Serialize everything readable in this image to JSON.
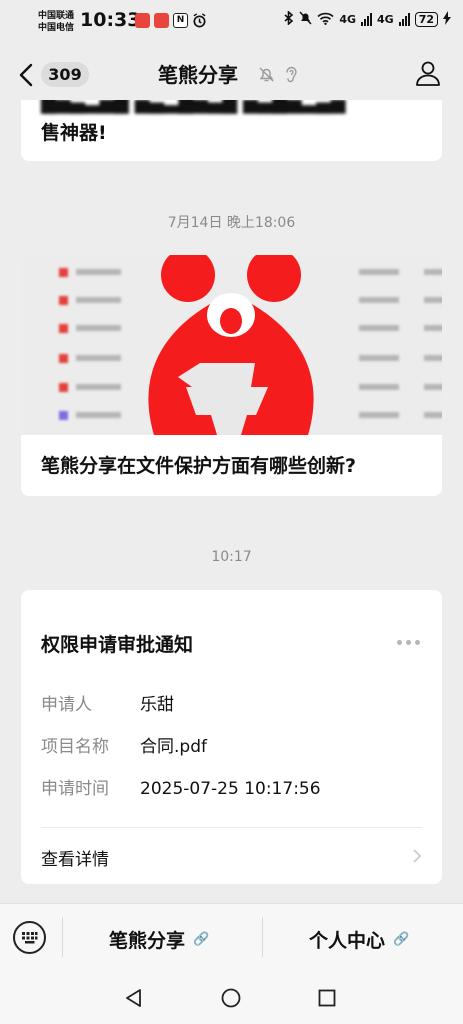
{
  "status_bar": {
    "carrier_1": "中国联通",
    "carrier_2": "中国电信",
    "time": "10:33",
    "network_1": "4G",
    "network_2": "4G",
    "battery": "72"
  },
  "header": {
    "unread_count": "309",
    "title": "笔熊分享"
  },
  "messages": [
    {
      "type": "article",
      "caption": "售神器!"
    },
    {
      "timestamp": "7月14日 晚上18:06",
      "type": "article",
      "caption": "笔熊分享在文件保护方面有哪些创新?"
    },
    {
      "timestamp": "10:17",
      "type": "notification",
      "title": "权限申请审批通知",
      "fields": [
        {
          "key": "申请人",
          "value": "乐甜"
        },
        {
          "key": "项目名称",
          "value": "合同.pdf"
        },
        {
          "key": "申请时间",
          "value": "2025-07-25 10:17:56"
        }
      ],
      "action": "查看详情"
    }
  ],
  "bottom_menu": {
    "item_1": "笔熊分享",
    "item_2": "个人中心"
  },
  "colors": {
    "bear_red": "#f41c1c",
    "background": "#ededed"
  }
}
